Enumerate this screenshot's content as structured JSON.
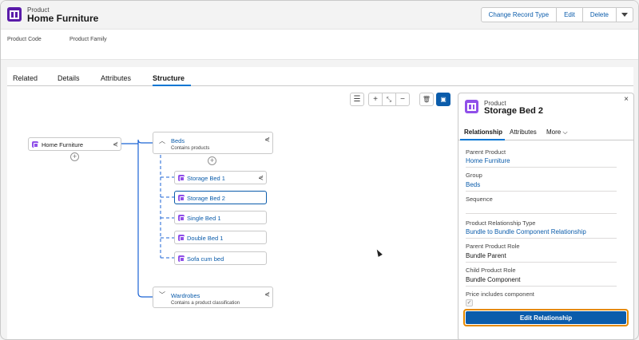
{
  "header": {
    "object_type": "Product",
    "title": "Home Furniture",
    "actions": [
      "Change Record Type",
      "Edit",
      "Delete"
    ],
    "fields": [
      "Product Code",
      "Product Family"
    ]
  },
  "tabs": [
    "Related",
    "Details",
    "Attributes",
    "Structure"
  ],
  "active_tab": "Structure",
  "toolbar": {
    "icons": [
      "list-icon",
      "plus-icon",
      "collapse-icon",
      "minus-icon",
      "trash-icon",
      "panel-icon"
    ]
  },
  "tree": {
    "root": "Home Furniture",
    "groups": [
      {
        "name": "Beds",
        "description": "Contains products",
        "children": [
          "Storage Bed 1",
          "Storage Bed 2",
          "Single Bed 1",
          "Double Bed 1",
          "Sofa cum bed"
        ]
      },
      {
        "name": "Wardrobes",
        "description": "Contains a product classification"
      }
    ]
  },
  "panel": {
    "object_type": "Product",
    "title": "Storage Bed 2",
    "tabs": [
      "Relationship",
      "Attributes",
      "More"
    ],
    "fields": [
      {
        "label": "Parent Product",
        "value": "Home Furniture",
        "link": true
      },
      {
        "label": "Group",
        "value": "Beds",
        "link": true
      },
      {
        "label": "Sequence",
        "value": "",
        "link": false
      },
      {
        "label": "Product Relationship Type",
        "value": "Bundle to Bundle Component Relationship",
        "link": true
      },
      {
        "label": "Parent Product Role",
        "value": "Bundle Parent",
        "link": false
      },
      {
        "label": "Child Product Role",
        "value": "Bundle Component",
        "link": false
      },
      {
        "label": "Price includes component",
        "value": "",
        "link": false
      }
    ],
    "checkbox_checked": true,
    "button": "Edit Relationship"
  },
  "colors": {
    "accent": "#0b5cab",
    "brand_icon": "#5a1ba9",
    "node_icon": "#9050e9",
    "highlight": "#e68a00"
  }
}
